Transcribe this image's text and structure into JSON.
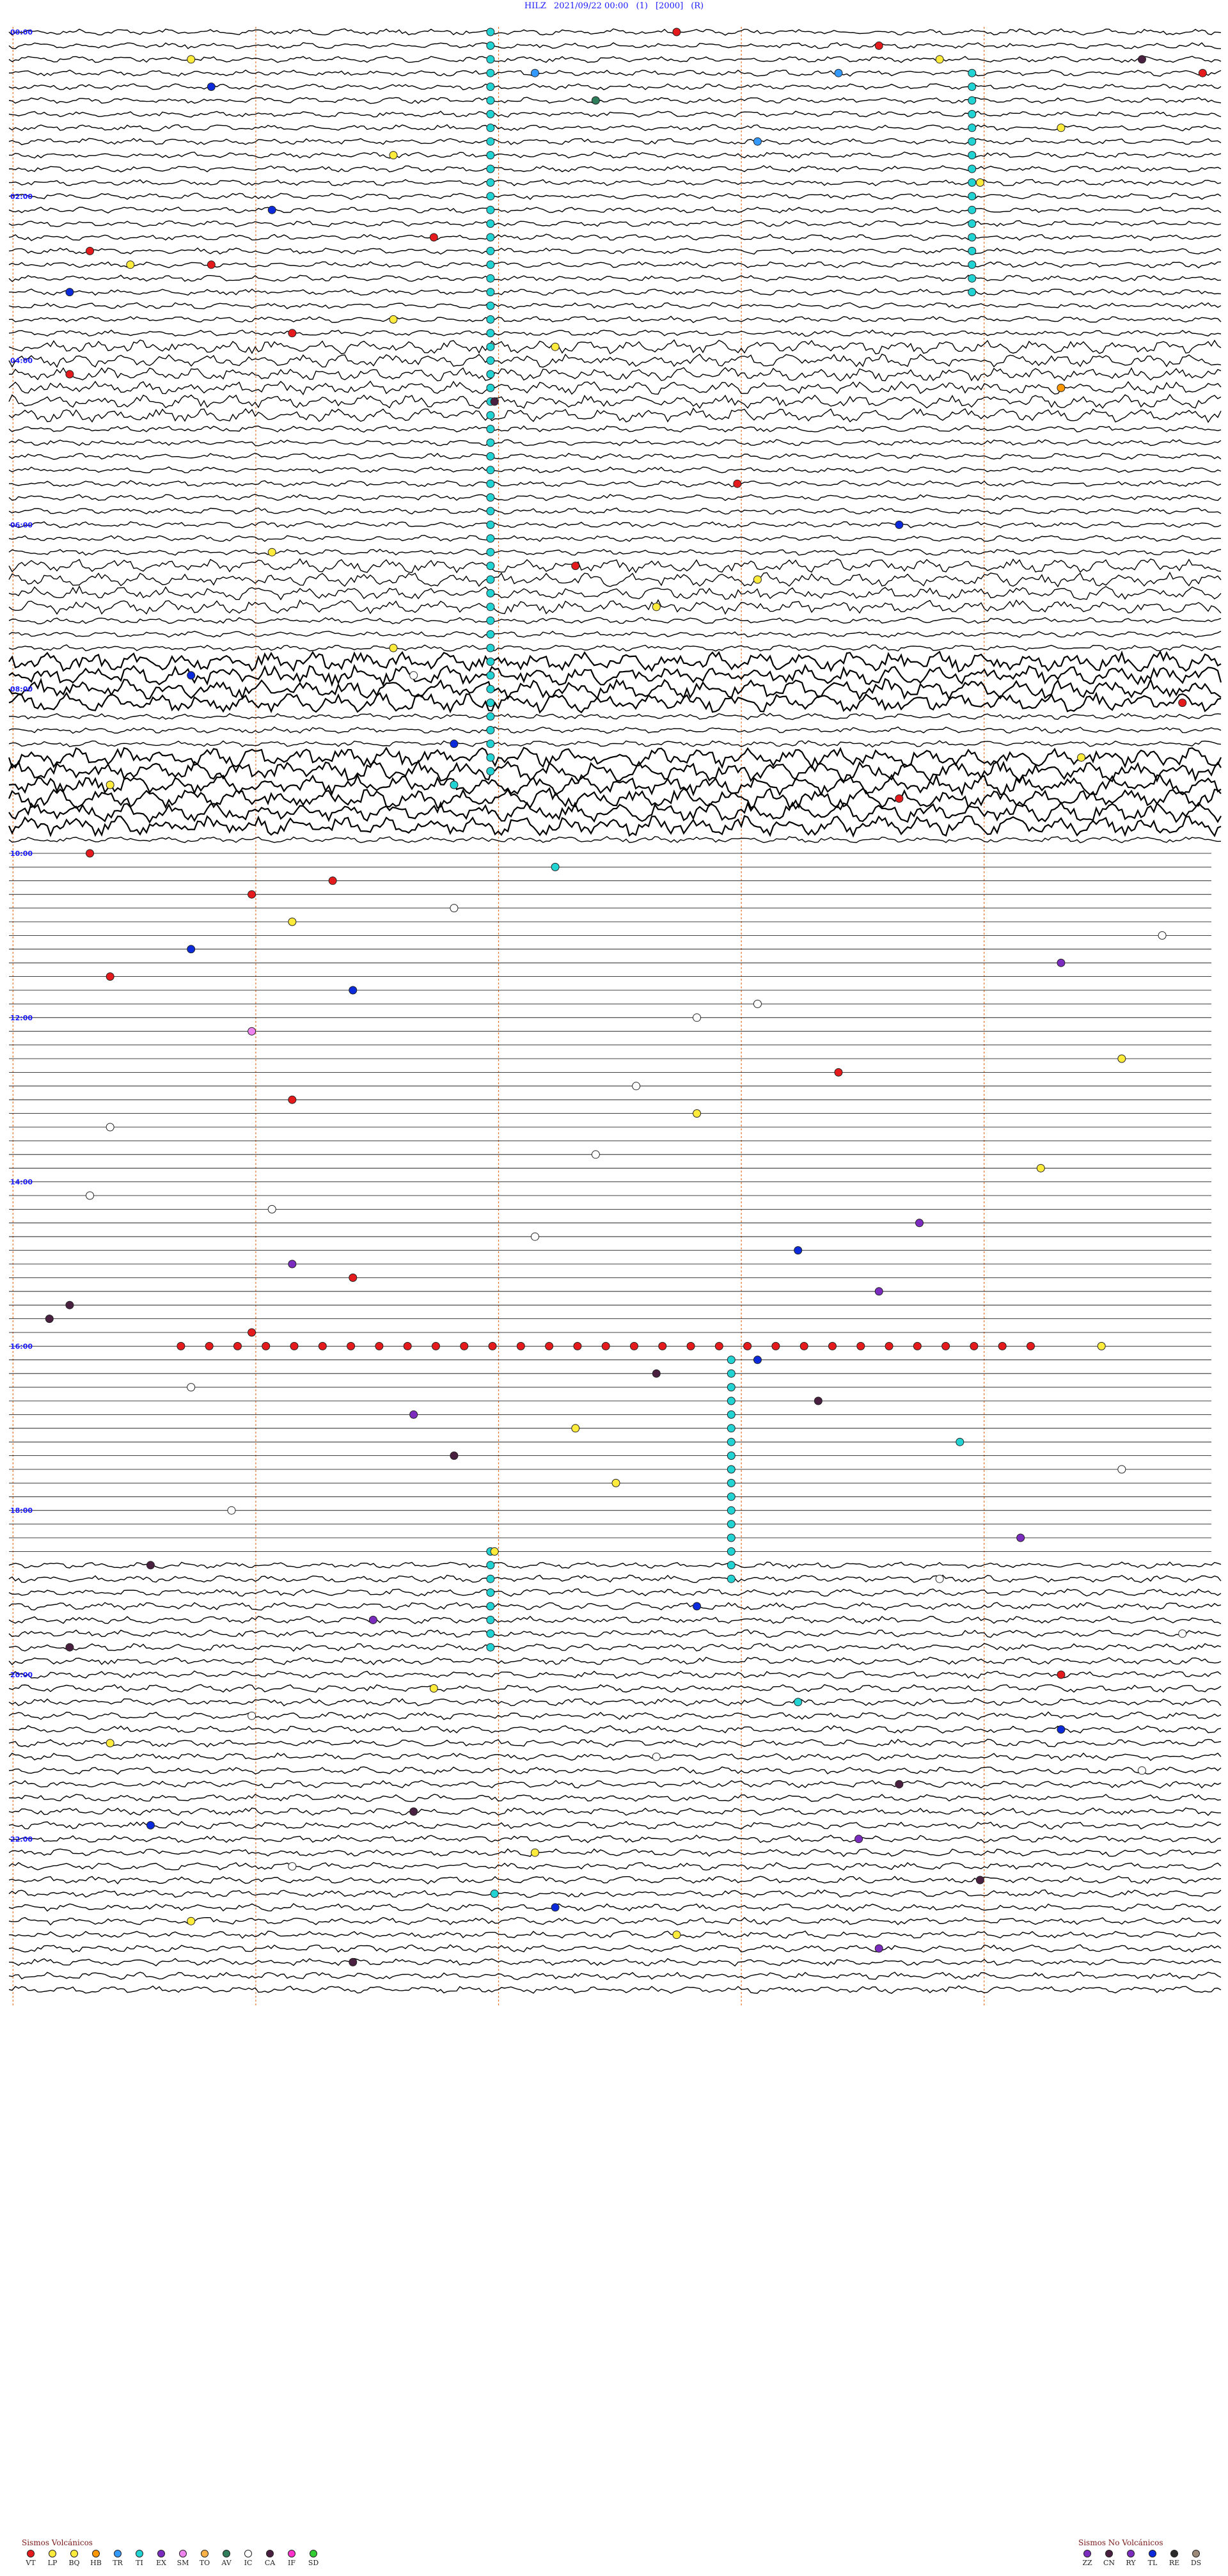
{
  "header": {
    "station": "HILZ",
    "datetime": "2021/09/22 00:00",
    "channel": "(1)",
    "scale": "[2000]",
    "mode": "(R)"
  },
  "chart_data": {
    "type": "helicorder",
    "station": "HILZ",
    "date": "2021/09/22",
    "hour_labels": [
      "00:00",
      "02:00",
      "04:00",
      "06:00",
      "08:00",
      "10:00",
      "12:00",
      "14:00",
      "16:00",
      "18:00",
      "20:00",
      "22:00"
    ],
    "labeled_hours": [
      0,
      2,
      4,
      6,
      8,
      10,
      12,
      14,
      16,
      18,
      20,
      22
    ],
    "rows_per_hour": 6,
    "total_rows": 144,
    "dotted_markers": 5,
    "colors": {
      "trace": "#000000",
      "hour_label": "#1a1aff",
      "marker_line": "#e8702a",
      "header": "#1a1aff"
    },
    "events": [
      {
        "row": 0,
        "minute": 33,
        "class": "VT"
      },
      {
        "row": 1,
        "minute": 43,
        "class": "VT"
      },
      {
        "row": 2,
        "minute": 9,
        "class": "BQ"
      },
      {
        "row": 2,
        "minute": 46,
        "class": "LP"
      },
      {
        "row": 2,
        "minute": 56,
        "class": "CA"
      },
      {
        "row": 3,
        "minute": 59,
        "class": "VT"
      },
      {
        "row": 3,
        "minute": 26,
        "class": "TR"
      },
      {
        "row": 3,
        "minute": 41,
        "class": "TR"
      },
      {
        "row": 4,
        "minute": 10,
        "class": "TL"
      },
      {
        "row": 5,
        "minute": 29,
        "class": "AV"
      },
      {
        "row": 7,
        "minute": 52,
        "class": "LP"
      },
      {
        "row": 8,
        "minute": 37,
        "class": "TR"
      },
      {
        "row": 9,
        "minute": 19,
        "class": "LP"
      },
      {
        "row": 11,
        "minute": 48,
        "class": "LP"
      },
      {
        "row": 13,
        "minute": 13,
        "class": "TL"
      },
      {
        "row": 15,
        "minute": 21,
        "class": "VT"
      },
      {
        "row": 16,
        "minute": 4,
        "class": "VT"
      },
      {
        "row": 17,
        "minute": 6,
        "class": "LP"
      },
      {
        "row": 17,
        "minute": 10,
        "class": "VT"
      },
      {
        "row": 19,
        "minute": 3,
        "class": "TL"
      },
      {
        "row": 21,
        "minute": 19,
        "class": "LP"
      },
      {
        "row": 22,
        "minute": 14,
        "class": "VT"
      },
      {
        "row": 23,
        "minute": 27,
        "class": "LP"
      },
      {
        "row": 25,
        "minute": 3,
        "class": "VT"
      },
      {
        "row": 26,
        "minute": 52,
        "class": "HB"
      },
      {
        "row": 27,
        "minute": 24,
        "class": "CA"
      },
      {
        "row": 33,
        "minute": 36,
        "class": "VT"
      },
      {
        "row": 36,
        "minute": 44,
        "class": "TL"
      },
      {
        "row": 38,
        "minute": 13,
        "class": "LP"
      },
      {
        "row": 39,
        "minute": 28,
        "class": "VT"
      },
      {
        "row": 40,
        "minute": 37,
        "class": "LP"
      },
      {
        "row": 42,
        "minute": 32,
        "class": "LP"
      },
      {
        "row": 45,
        "minute": 19,
        "class": "LP"
      },
      {
        "row": 47,
        "minute": 20,
        "class": "IC"
      },
      {
        "row": 47,
        "minute": 9,
        "class": "TL"
      },
      {
        "row": 49,
        "minute": 58,
        "class": "VT"
      },
      {
        "row": 52,
        "minute": 22,
        "class": "TL"
      },
      {
        "row": 53,
        "minute": 53,
        "class": "LP"
      },
      {
        "row": 55,
        "minute": 5,
        "class": "LP"
      },
      {
        "row": 55,
        "minute": 22,
        "class": "TI"
      },
      {
        "row": 56,
        "minute": 44,
        "class": "VT"
      },
      {
        "row": 60,
        "minute": 4,
        "class": "VT"
      },
      {
        "row": 61,
        "minute": 27,
        "class": "TI"
      },
      {
        "row": 62,
        "minute": 16,
        "class": "VT"
      },
      {
        "row": 63,
        "minute": 12,
        "class": "VT"
      },
      {
        "row": 64,
        "minute": 22,
        "class": "IC"
      },
      {
        "row": 65,
        "minute": 14,
        "class": "LP"
      },
      {
        "row": 66,
        "minute": 57,
        "class": "IC"
      },
      {
        "row": 67,
        "minute": 9,
        "class": "TL"
      },
      {
        "row": 68,
        "minute": 52,
        "class": "EX"
      },
      {
        "row": 69,
        "minute": 5,
        "class": "VT"
      },
      {
        "row": 70,
        "minute": 17,
        "class": "TL"
      },
      {
        "row": 71,
        "minute": 37,
        "class": "IC"
      },
      {
        "row": 72,
        "minute": 34,
        "class": "IC"
      },
      {
        "row": 73,
        "minute": 12,
        "class": "SM"
      },
      {
        "row": 75,
        "minute": 55,
        "class": "LP"
      },
      {
        "row": 76,
        "minute": 41,
        "class": "VT"
      },
      {
        "row": 77,
        "minute": 31,
        "class": "IC"
      },
      {
        "row": 78,
        "minute": 14,
        "class": "VT"
      },
      {
        "row": 79,
        "minute": 34,
        "class": "LP"
      },
      {
        "row": 80,
        "minute": 5,
        "class": "IC"
      },
      {
        "row": 82,
        "minute": 29,
        "class": "IC"
      },
      {
        "row": 83,
        "minute": 51,
        "class": "LP"
      },
      {
        "row": 85,
        "minute": 4,
        "class": "IC"
      },
      {
        "row": 86,
        "minute": 13,
        "class": "IC"
      },
      {
        "row": 87,
        "minute": 45,
        "class": "EX"
      },
      {
        "row": 88,
        "minute": 26,
        "class": "IC"
      },
      {
        "row": 89,
        "minute": 39,
        "class": "TL"
      },
      {
        "row": 90,
        "minute": 14,
        "class": "ZZ"
      },
      {
        "row": 91,
        "minute": 17,
        "class": "VT"
      },
      {
        "row": 92,
        "minute": 43,
        "class": "EX"
      },
      {
        "row": 93,
        "minute": 3,
        "class": "CA"
      },
      {
        "row": 94,
        "minute": 2,
        "class": "CA"
      },
      {
        "row": 95,
        "minute": 12,
        "class": "VT"
      },
      {
        "row": 96,
        "minute": 54,
        "class": "LP"
      },
      {
        "row": 97,
        "minute": 37,
        "class": "TL"
      },
      {
        "row": 98,
        "minute": 32,
        "class": "CA"
      },
      {
        "row": 99,
        "minute": 9,
        "class": "IC"
      },
      {
        "row": 100,
        "minute": 40,
        "class": "CA"
      },
      {
        "row": 101,
        "minute": 20,
        "class": "EX"
      },
      {
        "row": 102,
        "minute": 28,
        "class": "LP"
      },
      {
        "row": 103,
        "minute": 47,
        "class": "TI"
      },
      {
        "row": 104,
        "minute": 22,
        "class": "CA"
      },
      {
        "row": 105,
        "minute": 55,
        "class": "IC"
      },
      {
        "row": 106,
        "minute": 30,
        "class": "LP"
      },
      {
        "row": 108,
        "minute": 11,
        "class": "IC"
      },
      {
        "row": 110,
        "minute": 50,
        "class": "EX"
      },
      {
        "row": 111,
        "minute": 24,
        "class": "LP"
      },
      {
        "row": 112,
        "minute": 7,
        "class": "CA"
      },
      {
        "row": 113,
        "minute": 46,
        "class": "IC"
      },
      {
        "row": 115,
        "minute": 34,
        "class": "TL"
      },
      {
        "row": 116,
        "minute": 18,
        "class": "EX"
      },
      {
        "row": 117,
        "minute": 58,
        "class": "IC"
      },
      {
        "row": 118,
        "minute": 3,
        "class": "CA"
      },
      {
        "row": 120,
        "minute": 52,
        "class": "VT"
      },
      {
        "row": 121,
        "minute": 21,
        "class": "LP"
      },
      {
        "row": 122,
        "minute": 39,
        "class": "TI"
      },
      {
        "row": 123,
        "minute": 12,
        "class": "IC"
      },
      {
        "row": 124,
        "minute": 52,
        "class": "TL"
      },
      {
        "row": 125,
        "minute": 5,
        "class": "LP"
      },
      {
        "row": 126,
        "minute": 32,
        "class": "IC"
      },
      {
        "row": 127,
        "minute": 56,
        "class": "IC"
      },
      {
        "row": 128,
        "minute": 44,
        "class": "CA"
      },
      {
        "row": 130,
        "minute": 20,
        "class": "CA"
      },
      {
        "row": 131,
        "minute": 7,
        "class": "TL"
      },
      {
        "row": 132,
        "minute": 42,
        "class": "EX"
      },
      {
        "row": 133,
        "minute": 26,
        "class": "LP"
      },
      {
        "row": 134,
        "minute": 14,
        "class": "IC"
      },
      {
        "row": 135,
        "minute": 48,
        "class": "CA"
      },
      {
        "row": 136,
        "minute": 24,
        "class": "TI"
      },
      {
        "row": 137,
        "minute": 27,
        "class": "TL"
      },
      {
        "row": 138,
        "minute": 9,
        "class": "LP"
      },
      {
        "row": 139,
        "minute": 33,
        "class": "LP"
      },
      {
        "row": 140,
        "minute": 43,
        "class": "EX"
      },
      {
        "row": 141,
        "minute": 17,
        "class": "CA"
      }
    ],
    "tremor_columns": [
      {
        "minute": 23.8,
        "row_start": 0,
        "row_end": 54,
        "class": "TI"
      },
      {
        "minute": 47.6,
        "row_start": 3,
        "row_end": 19,
        "class": "TI"
      },
      {
        "minute": 35.7,
        "row_start": 97,
        "row_end": 113,
        "class": "TI"
      },
      {
        "minute": 23.8,
        "row_start": 111,
        "row_end": 118,
        "class": "TI"
      }
    ],
    "event_chain": {
      "row": 96,
      "minute_start": 8.5,
      "minute_end": 50.5,
      "count": 31,
      "class": "VT"
    },
    "noisy_bands": [
      {
        "row_start": 23,
        "row_end": 28,
        "amplitude": "high"
      },
      {
        "row_start": 39,
        "row_end": 42,
        "amplitude": "high"
      },
      {
        "row_start": 46,
        "row_end": 49,
        "amplitude": "very-high"
      },
      {
        "row_start": 53,
        "row_end": 58,
        "amplitude": "very-high"
      }
    ],
    "quiet_rows": {
      "start": 60,
      "end": 112
    }
  },
  "legend": {
    "volcanic": {
      "title": "Sismos Volcánicos",
      "items": [
        {
          "code": "VT",
          "color": "#e41a1c"
        },
        {
          "code": "LP",
          "color": "#ffeb3b"
        },
        {
          "code": "BQ",
          "color": "#ffeb3b"
        },
        {
          "code": "HB",
          "color": "#ff9800"
        },
        {
          "code": "TR",
          "color": "#3399ff"
        },
        {
          "code": "TI",
          "color": "#22d3d3"
        },
        {
          "code": "EX",
          "color": "#7b2cbf"
        },
        {
          "code": "SM",
          "color": "#ee82ee"
        },
        {
          "code": "TO",
          "color": "#ffb347"
        },
        {
          "code": "AV",
          "color": "#2e7d5b"
        },
        {
          "code": "IC",
          "color": "#ffffff"
        },
        {
          "code": "CA",
          "color": "#4a2040"
        },
        {
          "code": "IF",
          "color": "#ff33cc"
        },
        {
          "code": "SD",
          "color": "#33cc33"
        }
      ]
    },
    "nonvolcanic": {
      "title": "Sismos No Volcánicos",
      "items": [
        {
          "code": "ZZ",
          "color": "#7b2cbf"
        },
        {
          "code": "CN",
          "color": "#4a2040"
        },
        {
          "code": "RY",
          "color": "#7b2cbf"
        },
        {
          "code": "TL",
          "color": "#0a2adb"
        },
        {
          "code": "RE",
          "color": "#2b2b2b"
        },
        {
          "code": "DS",
          "color": "#9b8a7a"
        }
      ]
    }
  }
}
